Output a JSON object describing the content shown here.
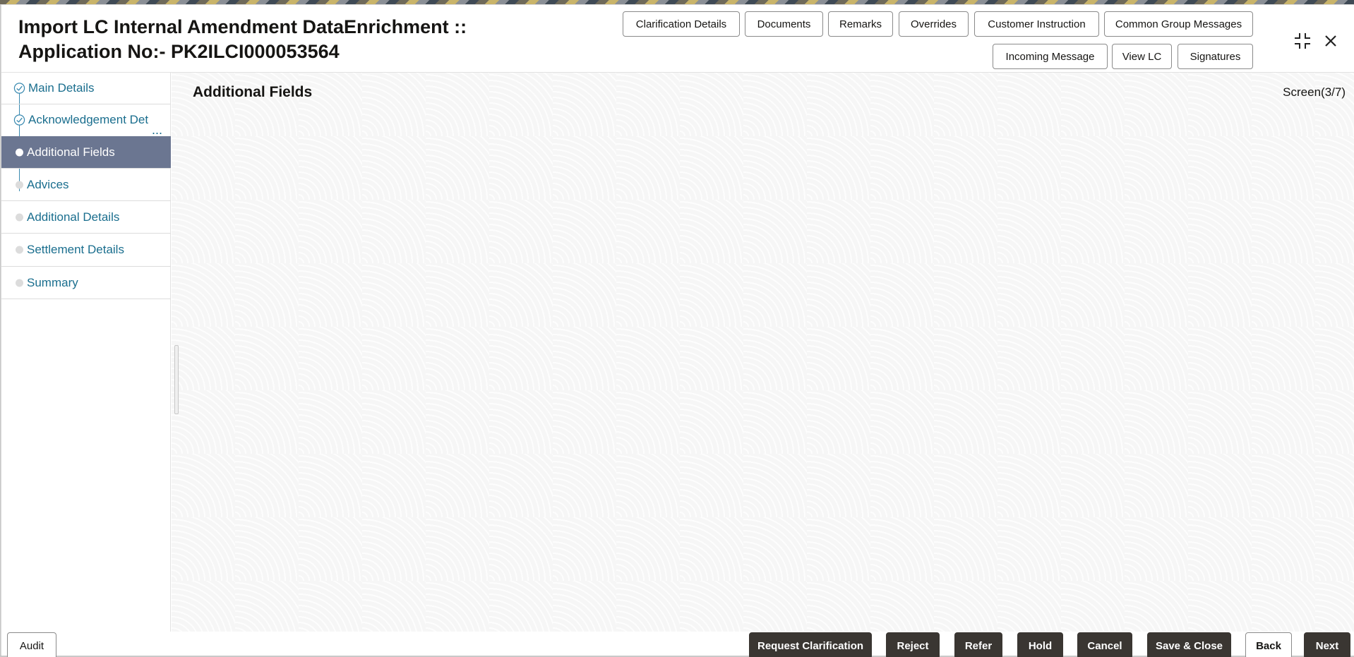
{
  "header": {
    "title": "Import LC Internal Amendment DataEnrichment :: Application No:- PK2ILCI000053564",
    "buttons": [
      "Clarification Details",
      "Documents",
      "Remarks",
      "Overrides",
      "Customer Instruction",
      "Common Group Messages",
      "Incoming Message",
      "View LC",
      "Signatures"
    ],
    "icons": [
      "minimize-icon",
      "close-icon"
    ]
  },
  "sidebar": {
    "steps": [
      {
        "label": "Main Details",
        "state": "completed"
      },
      {
        "label": "Acknowledgement Det",
        "state": "completed",
        "truncated": true
      },
      {
        "label": "Additional Fields",
        "state": "active"
      },
      {
        "label": "Advices",
        "state": "pending"
      },
      {
        "label": "Additional Details",
        "state": "pending"
      },
      {
        "label": "Settlement Details",
        "state": "pending"
      },
      {
        "label": "Summary",
        "state": "pending"
      }
    ],
    "ellipsis": "..."
  },
  "main": {
    "title": "Additional Fields",
    "screen_counter": "Screen(3/7)"
  },
  "footer": {
    "audit": "Audit",
    "actions": [
      "Request Clarification",
      "Reject",
      "Refer",
      "Hold",
      "Cancel",
      "Save & Close"
    ],
    "back": "Back",
    "next": "Next"
  },
  "colors": {
    "active_step_bg": "#6b7691",
    "link_text": "#1a6e8e",
    "dark_button": "#3a3632"
  }
}
